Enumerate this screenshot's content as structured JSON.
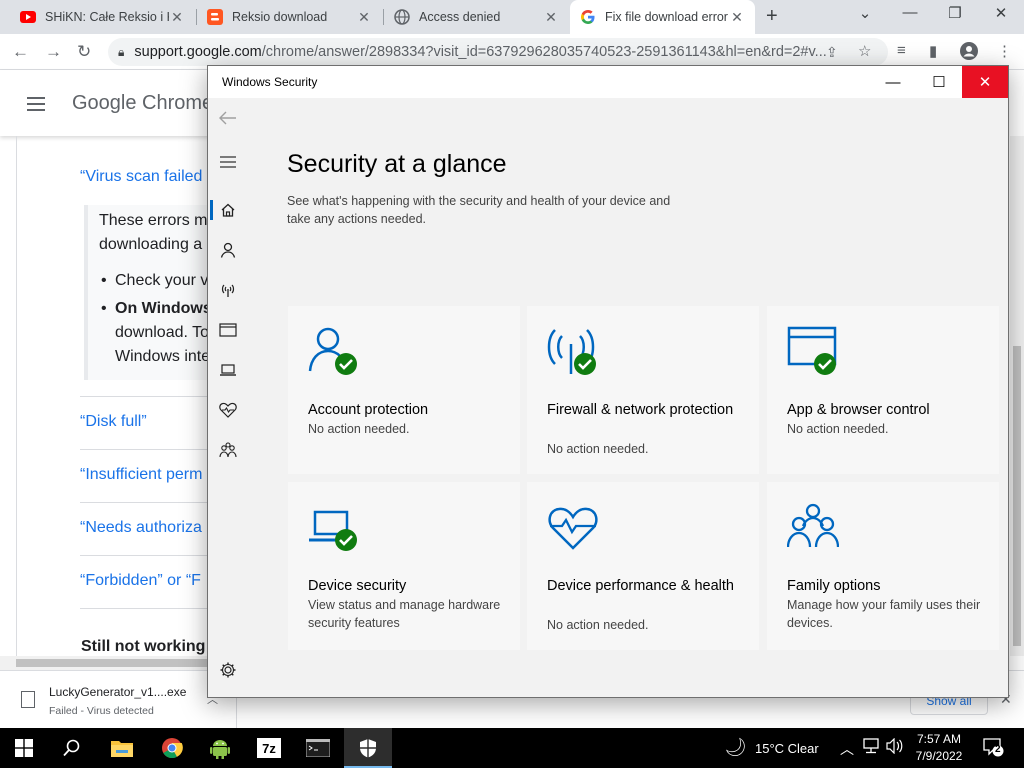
{
  "browser": {
    "tabs": [
      {
        "title": "SHiKN: Całe Reksio i Ka",
        "favicon": "youtube-icon",
        "active": false
      },
      {
        "title": "Reksio download",
        "favicon": "blogger-icon",
        "active": false
      },
      {
        "title": "Access denied",
        "favicon": "globe-icon",
        "active": false
      },
      {
        "title": "Fix file download error",
        "favicon": "google-icon",
        "active": true
      }
    ],
    "url_host": "support.google.com",
    "url_path": "/chrome/answer/2898334?visit_id=637929628035740523-2591361143&hl=en&rd=2#v..."
  },
  "page": {
    "brand": "Google Chrome",
    "links": [
      "“Virus scan failed",
      "“Disk full”",
      "“Insufficient perm",
      "“Needs authoriza",
      "“Forbidden” or “F"
    ],
    "callout_lines": [
      "These errors m",
      "downloading a"
    ],
    "bullets": [
      "Check your v",
      "On Windows"
    ],
    "bullet_cont": [
      "download. To",
      "Windows inte"
    ],
    "still_heading": "Still not working"
  },
  "download": {
    "filename": "LuckyGenerator_v1....exe",
    "status": "Failed - Virus detected",
    "show_all": "Show all"
  },
  "ws": {
    "window_title": "Windows Security",
    "heading": "Security at a glance",
    "subtitle": "See what's happening with the security and health of your device and take any actions needed.",
    "tiles": [
      {
        "name": "Account protection",
        "desc": "No action needed.",
        "icon": "account-protection-icon",
        "ok": true
      },
      {
        "name": "Firewall & network protection",
        "desc": "No action needed.",
        "icon": "firewall-icon",
        "ok": true
      },
      {
        "name": "App & browser control",
        "desc": "No action needed.",
        "icon": "app-browser-icon",
        "ok": true
      },
      {
        "name": "Device security",
        "desc": "View status and manage hardware security features",
        "icon": "device-security-icon",
        "ok": true
      },
      {
        "name": "Device performance & health",
        "desc": "No action needed.",
        "icon": "device-health-icon",
        "ok": false
      },
      {
        "name": "Family options",
        "desc": "Manage how your family uses their devices.",
        "icon": "family-icon",
        "ok": false
      }
    ],
    "accent": "#0067c0",
    "ok_color": "#107c10"
  },
  "taskbar": {
    "weather": "15°C  Clear",
    "time": "7:57 AM",
    "date": "7/9/2022",
    "notifications": "2"
  }
}
